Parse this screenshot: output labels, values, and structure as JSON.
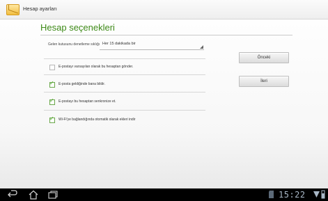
{
  "titlebar": {
    "title": "Hesap ayarları"
  },
  "page": {
    "heading": "Hesap seçenekleri"
  },
  "check_frequency": {
    "label": "Gelen kutusunu denetleme sıklığı",
    "value": "Her 15 dakikada bir"
  },
  "preferences": [
    {
      "label": "E-postayı varsayılan olarak bu hesaptan gönder.",
      "checked": false
    },
    {
      "label": "E-posta geldiğinde bana bildir.",
      "checked": true
    },
    {
      "label": "E-postayı bu hesaptan senkronize et.",
      "checked": true
    },
    {
      "label": "Wi-Fi'ye bağlandığında otomatik olarak ekleri indir",
      "checked": true
    }
  ],
  "buttons": {
    "previous": "Önceki",
    "next": "İleri"
  },
  "statusbar": {
    "time": "15:22"
  },
  "colors": {
    "heading": "#3e8a18",
    "check": "#49a624",
    "clock": "#a8b7c6"
  }
}
